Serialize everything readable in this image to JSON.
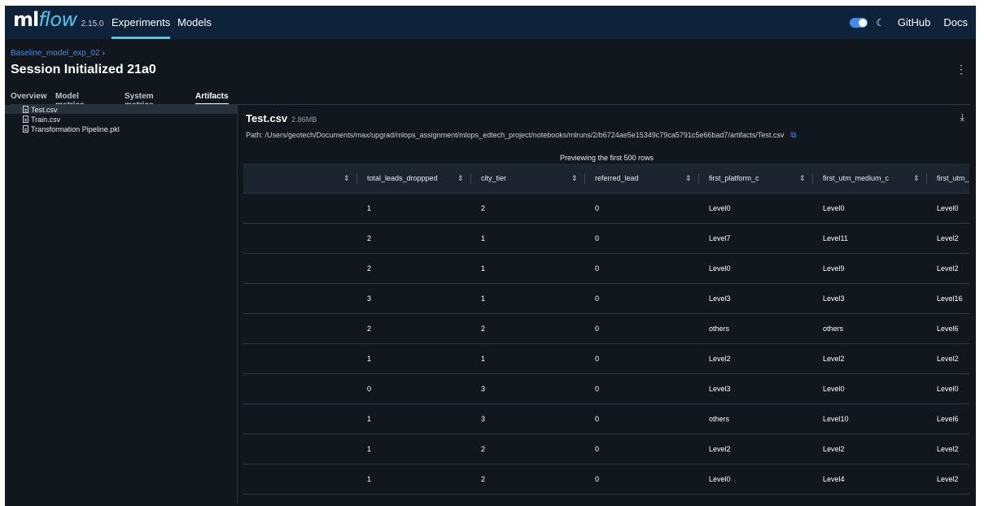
{
  "topbar": {
    "logo_ml": "ml",
    "logo_flow": "flow",
    "version": "2.15.0",
    "nav_experiments": "Experiments",
    "nav_models": "Models",
    "github": "GitHub",
    "docs": "Docs",
    "accent_color": "#43c9ed"
  },
  "header": {
    "breadcrumb": "Baseline_model_exp_02",
    "breadcrumb_chevron": "›",
    "title": "Session Initialized 21a0",
    "kebab": "⋮"
  },
  "tabs": [
    {
      "label": "Overview"
    },
    {
      "label": "Model metrics"
    },
    {
      "label": "System metrics"
    },
    {
      "label": "Artifacts"
    }
  ],
  "files": [
    {
      "name": "Test.csv",
      "selected": true
    },
    {
      "name": "Train.csv"
    },
    {
      "name": "Transformation Pipeline.pkl"
    }
  ],
  "preview": {
    "file_name": "Test.csv",
    "file_size": "2.86MB",
    "path": "Path: /Users/geotech/Documents/max/upgrad/mlops_assignment/mlops_edtech_project/notebooks/mlruns/2/b6724ae5e15349c79ca5791c5e66bad7/artifacts/Test.csv",
    "note": "Previewing the first 500 rows"
  },
  "table": {
    "columns": [
      "",
      "total_leads_droppped",
      "city_tier",
      "referred_lead",
      "first_platform_c",
      "first_utm_medium_c",
      "first_utm_"
    ],
    "rows": [
      [
        "1",
        "2",
        "0",
        "Level0",
        "Level0",
        "Level0"
      ],
      [
        "2",
        "1",
        "0",
        "Level7",
        "Level11",
        "Level2"
      ],
      [
        "2",
        "1",
        "0",
        "Level0",
        "Level9",
        "Level2"
      ],
      [
        "3",
        "1",
        "0",
        "Level3",
        "Level3",
        "Level16"
      ],
      [
        "2",
        "2",
        "0",
        "others",
        "others",
        "Level6"
      ],
      [
        "1",
        "1",
        "0",
        "Level2",
        "Level2",
        "Level2"
      ],
      [
        "0",
        "3",
        "0",
        "Level3",
        "Level0",
        "Level0"
      ],
      [
        "1",
        "3",
        "0",
        "others",
        "Level10",
        "Level6"
      ],
      [
        "1",
        "2",
        "0",
        "Level2",
        "Level2",
        "Level2"
      ],
      [
        "1",
        "2",
        "0",
        "Level0",
        "Level4",
        "Level2"
      ]
    ]
  }
}
